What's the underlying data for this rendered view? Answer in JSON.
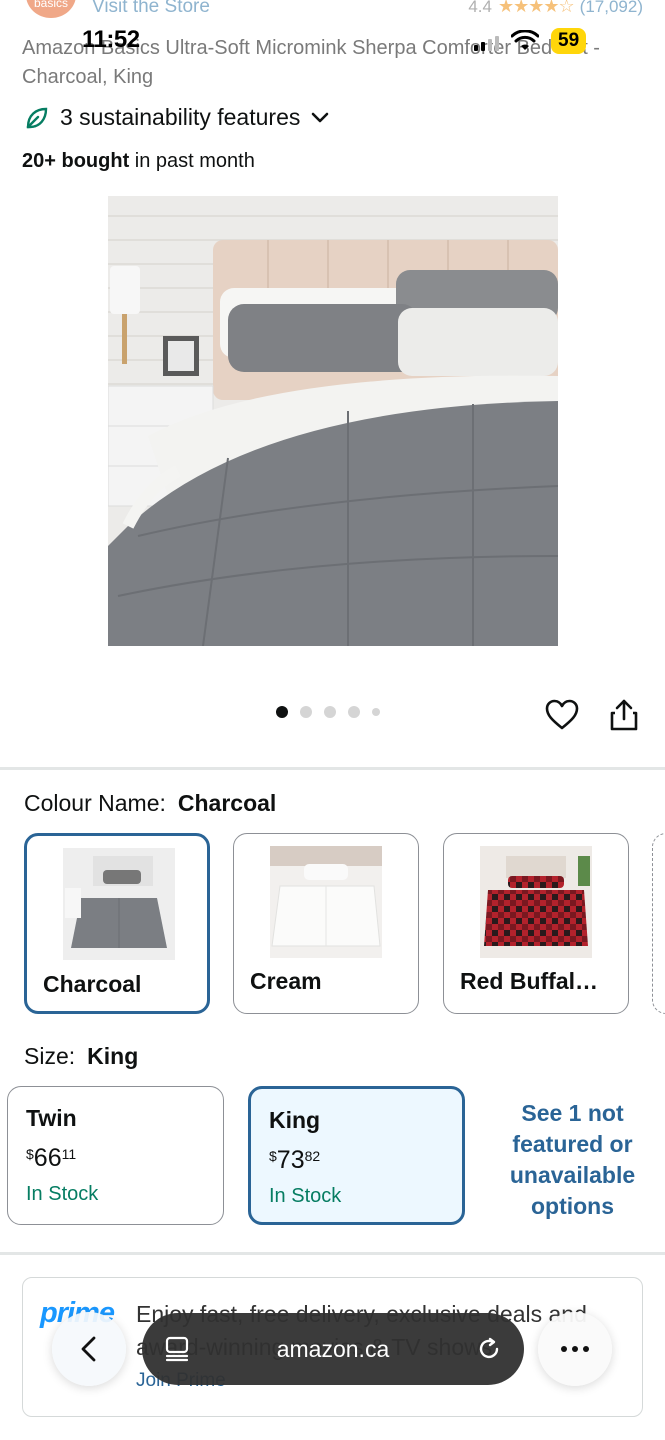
{
  "header": {
    "brand_logo_text": "basics",
    "visit_store": "Visit the Store",
    "rating": "4.4",
    "stars": "★★★★☆",
    "rating_count": "(17,092)",
    "title": "Amazon Basics Ultra-Soft Micromink Sherpa Comforter Bed Set - Charcoal, King"
  },
  "status_bar": {
    "time": "11:52",
    "battery": "59"
  },
  "sustainability": {
    "label": "3 sustainability features"
  },
  "bought": {
    "bold": "20+ bought",
    "rest": " in past month"
  },
  "gallery": {
    "dot_count": 5,
    "active_index": 0
  },
  "colour": {
    "label": "Colour Name:",
    "selected": "Charcoal",
    "options": [
      {
        "label": "Charcoal",
        "selected": true
      },
      {
        "label": "Cream",
        "selected": false
      },
      {
        "label": "Red Buffal…",
        "selected": false
      }
    ]
  },
  "size": {
    "label": "Size:",
    "selected": "King",
    "options": [
      {
        "name": "Twin",
        "currency": "$",
        "dollars": "66",
        "cents": "11",
        "stock": "In Stock",
        "selected": false
      },
      {
        "name": "King",
        "currency": "$",
        "dollars": "73",
        "cents": "82",
        "stock": "In Stock",
        "selected": true
      }
    ],
    "see_more": "See 1 not featured or unavailable options"
  },
  "prime": {
    "logo": "prime",
    "text": "Enjoy fast, free delivery, exclusive deals and award-winning movies & TV shows",
    "join": "Join Prime"
  },
  "browser": {
    "url": "amazon.ca"
  },
  "colors": {
    "accent_blue": "#2a6496",
    "stock_green": "#067d62",
    "prime_blue": "#1a98ff"
  }
}
